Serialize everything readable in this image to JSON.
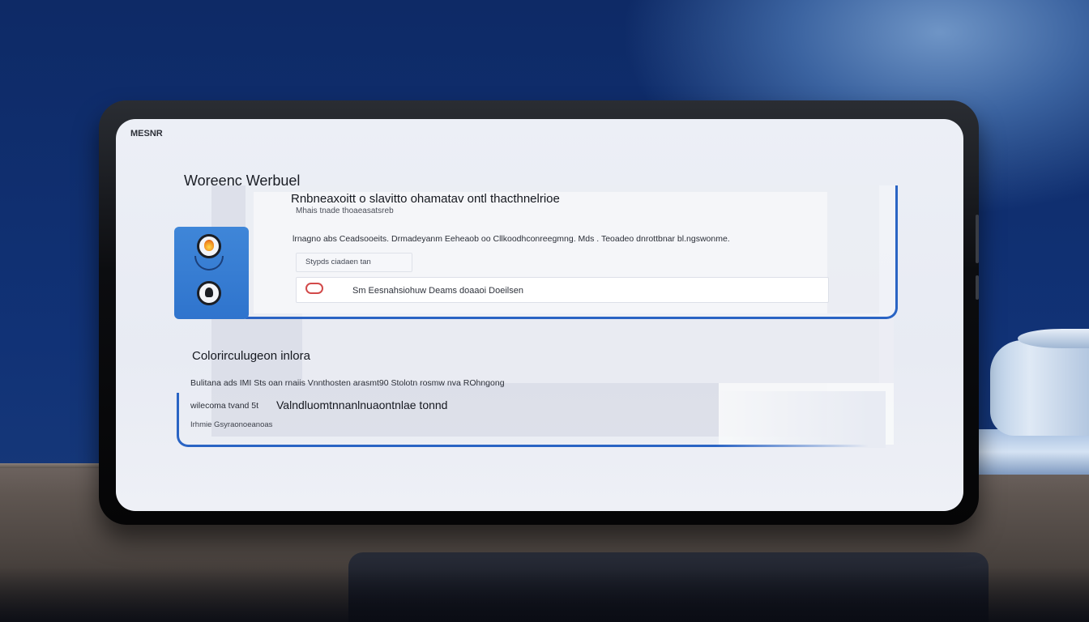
{
  "screen": {
    "menu_label": "MESNR",
    "app_title": "Woreenc Werbuel"
  },
  "main_card": {
    "heading": "Rnbneaxoitt o slavitto ohamatav ontl thacthnelrioe",
    "subheading": "Mhais tnade thoaeasatsreb",
    "description": "lrnagno abs  Ceadsooeits. Drmadeyanm Eeheaob oo Cllkoodhconreegmng. Mds .  Teoadeo dnrottbnar bl.ngswonme.",
    "chip_label": "Stypds ciadaen tan",
    "search_text": "Sm  Eesnahsiohuw Deams doaaoi Doeilsen"
  },
  "section2": {
    "title": "Colorirculugeon inlora",
    "line1": "Bulitana ads IMI  Sts  oan rnaiis Vnnthosten arasmt90 Stolotn rosmw  nva  ROhngong",
    "line2_prefix": "wilecoma tvand  5t",
    "line2_main": "Valndluomtnnanlnuaontnlae tonnd",
    "line3": "Irhmie  Gsyraonoeanoas"
  },
  "icons": {
    "sidebar_icon_1": "flame-icon",
    "sidebar_icon_2": "person-icon",
    "search_icon": "search-icon"
  },
  "colors": {
    "accent": "#2a64c4",
    "icon_panel": "#3a7fd5"
  }
}
